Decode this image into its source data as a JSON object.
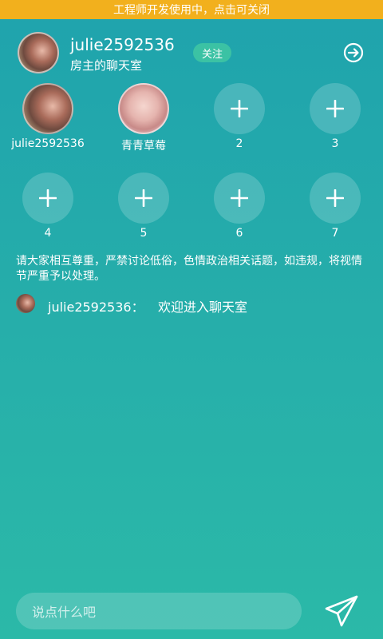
{
  "status_bar": {
    "text": "工程师开发使用中，点击可关闭"
  },
  "host": {
    "name": "julie2592536",
    "subtitle": "房主的聊天室",
    "follow_label": "关注"
  },
  "seats_row1": [
    {
      "label": "julie2592536",
      "kind": "avatar-a"
    },
    {
      "label": "青青草莓",
      "kind": "avatar-b"
    },
    {
      "label": "2",
      "kind": "empty"
    },
    {
      "label": "3",
      "kind": "empty"
    }
  ],
  "seats_row2": [
    {
      "label": "4",
      "kind": "empty"
    },
    {
      "label": "5",
      "kind": "empty"
    },
    {
      "label": "6",
      "kind": "empty"
    },
    {
      "label": "7",
      "kind": "empty"
    }
  ],
  "notice": "请大家相互尊重，严禁讨论低俗，色情政治相关话题，如违规，将视情节严重予以处理。",
  "messages": [
    {
      "user": "julie2592536：",
      "text": "欢迎进入聊天室"
    }
  ],
  "input": {
    "placeholder": "说点什么吧"
  },
  "icons": {
    "exit": "exit-arrow-icon",
    "add": "plus-icon",
    "send": "paper-plane-icon"
  }
}
